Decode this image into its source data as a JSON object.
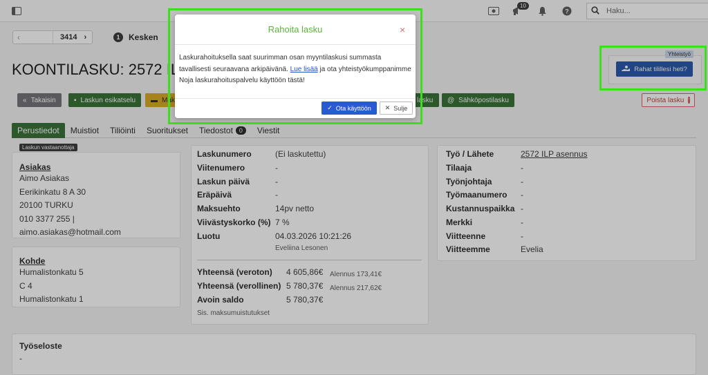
{
  "topbar": {
    "notifications_count": "10",
    "search_placeholder": "Haku..."
  },
  "pager": {
    "number": "3414"
  },
  "status": {
    "step": "1",
    "label": "Kesken"
  },
  "page_title": "KOONTILASKU: 2572 ILP A",
  "actions": {
    "back": "Takaisin",
    "preview": "Laskun esikatselu",
    "payment": "Maks",
    "invoice_partial": "lasku",
    "email_invoice": "Sähköpostilasku",
    "delete": "Poista lasku",
    "delete_badge": "!"
  },
  "partner": {
    "tag": "Yhteistyö",
    "button": "Rahat tilillesi heti?"
  },
  "tabs": [
    {
      "label": "Perustiedot"
    },
    {
      "label": "Muistiot"
    },
    {
      "label": "Tiliöinti"
    },
    {
      "label": "Suoritukset"
    },
    {
      "label": "Tiedostot",
      "count": "0"
    },
    {
      "label": "Viestit"
    }
  ],
  "recipient": {
    "tag": "Laskun vastaanottaja",
    "title": "Asiakas",
    "lines": [
      "Aimo Asiakas",
      "Eerikinkatu 8 A 30",
      "20100 TURKU",
      "010 3377 255 |",
      "aimo.asiakas@hotmail.com"
    ]
  },
  "target": {
    "title": "Kohde",
    "lines": [
      "Humalistonkatu 5",
      "C 4",
      "Humalistonkatu 1"
    ]
  },
  "invoice_info": [
    {
      "label": "Laskunumero",
      "value": "(Ei laskutettu)"
    },
    {
      "label": "Viitenumero",
      "value": "-"
    },
    {
      "label": "Laskun päivä",
      "value": "-"
    },
    {
      "label": "Eräpäivä",
      "value": "-"
    },
    {
      "label": "Maksuehto",
      "value": "14pv netto"
    },
    {
      "label": "Viivästyskorko (%)",
      "value": "7 %"
    },
    {
      "label": "Luotu",
      "value": "04.03.2026 10:21:26",
      "sub": "Eveliina Lesonen"
    }
  ],
  "totals": [
    {
      "label": "Yhteensä (veroton)",
      "value": "4 605,86€",
      "discount": "Alennus 173,41€"
    },
    {
      "label": "Yhteensä (verollinen)",
      "value": "5 780,37€",
      "discount": "Alennus 217,62€"
    },
    {
      "label": "Avoin saldo",
      "value": "5 780,37€",
      "discount": ""
    }
  ],
  "totals_note": "Sis. maksumuistutukset",
  "work_info": [
    {
      "label": "Työ / Lähete",
      "value": "2572 ILP asennus"
    },
    {
      "label": "Tilaaja",
      "value": "-"
    },
    {
      "label": "Työnjohtaja",
      "value": "-"
    },
    {
      "label": "Työmaanumero",
      "value": "-"
    },
    {
      "label": "Kustannuspaikka",
      "value": "-"
    },
    {
      "label": "Merkki",
      "value": "-"
    },
    {
      "label": "Viitteenne",
      "value": "-"
    },
    {
      "label": "Viitteemme",
      "value": "Evelia"
    }
  ],
  "work_report": {
    "title": "Työseloste",
    "value": "-"
  },
  "modal": {
    "title": "Rahoita lasku",
    "close": "×",
    "body_before": "Laskurahoituksella saat suurimman osan myyntilaskusi summasta tavallisesti seuraavana arkipäivänä.",
    "link": "Lue lisää",
    "body_after": "ja ota yhteistyökumppanimme Noja laskurahoituspalvelu käyttöön tästä!",
    "primary": "Ota käyttöön",
    "secondary": "Sulje"
  },
  "colors": {
    "accent_green": "#2e6b2e",
    "primary_blue": "#2a5ad1",
    "highlight": "#3cde1e",
    "modal_title": "#5fb144"
  }
}
